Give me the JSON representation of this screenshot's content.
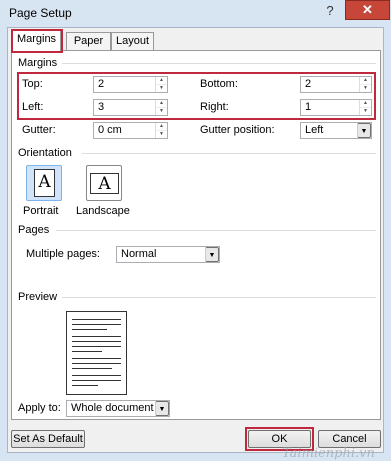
{
  "window": {
    "title": "Page Setup",
    "help_glyph": "?",
    "close_glyph": "✕"
  },
  "tabs": [
    {
      "label": "Margins",
      "active": true
    },
    {
      "label": "Paper",
      "active": false
    },
    {
      "label": "Layout",
      "active": false
    }
  ],
  "margins": {
    "section_label": "Margins",
    "top": {
      "label": "Top:",
      "value": "2"
    },
    "bottom": {
      "label": "Bottom:",
      "value": "2"
    },
    "left": {
      "label": "Left:",
      "value": "3"
    },
    "right": {
      "label": "Right:",
      "value": "1"
    },
    "gutter": {
      "label": "Gutter:",
      "value": "0 cm"
    },
    "gutter_position": {
      "label": "Gutter position:",
      "value": "Left"
    }
  },
  "orientation": {
    "section_label": "Orientation",
    "portrait_label": "Portrait",
    "landscape_label": "Landscape",
    "glyph": "A",
    "selected": "Portrait"
  },
  "pages": {
    "section_label": "Pages",
    "multiple_label": "Multiple pages:",
    "multiple_value": "Normal"
  },
  "preview": {
    "section_label": "Preview"
  },
  "apply": {
    "label": "Apply to:",
    "value": "Whole document"
  },
  "buttons": {
    "set_default": "Set As Default",
    "ok": "OK",
    "cancel": "Cancel"
  },
  "watermark": "Taimienphi.vn",
  "colors": {
    "highlight_red": "#c0283e",
    "close_red": "#c7463a",
    "frame_blue": "#d7e4f2"
  }
}
